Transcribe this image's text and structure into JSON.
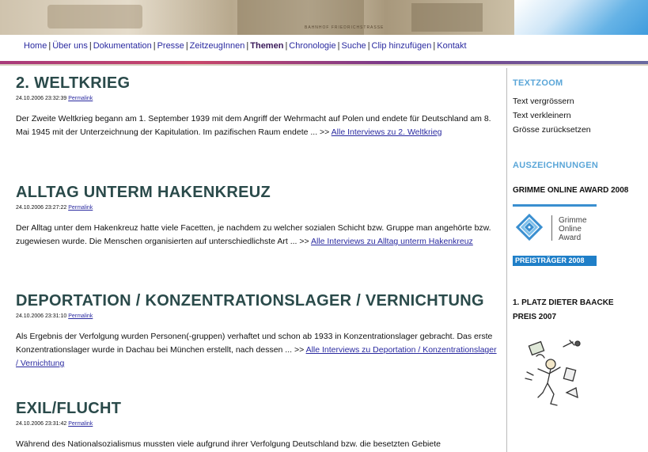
{
  "banner": {
    "caption": "BAHNHOF FRIEDRICHSTRASSE"
  },
  "nav": {
    "items": [
      {
        "label": "Home",
        "active": false
      },
      {
        "label": "Über uns",
        "active": false
      },
      {
        "label": "Dokumentation",
        "active": false
      },
      {
        "label": "Presse",
        "active": false
      },
      {
        "label": "ZeitzeugInnen",
        "active": false
      },
      {
        "label": "Themen",
        "active": true
      },
      {
        "label": "Chronologie",
        "active": false
      },
      {
        "label": "Suche",
        "active": false
      },
      {
        "label": "Clip hinzufügen",
        "active": false
      },
      {
        "label": "Kontakt",
        "active": false
      }
    ],
    "separator": "|"
  },
  "articles": [
    {
      "title": "2. WELTKRIEG",
      "timestamp": "24.10.2006 23:32:39",
      "permalink": "Permalink",
      "text": "Der Zweite Weltkrieg begann am 1. September 1939 mit dem Angriff der Wehrmacht auf Polen und endete für Deutschland am 8. Mai 1945 mit der Unterzeichnung der Kapitulation. Im pazifischen Raum endete ... >> ",
      "link": "Alle Interviews zu 2. Weltkrieg"
    },
    {
      "title": "ALLTAG UNTERM HAKENKREUZ",
      "timestamp": "24.10.2006 23:27:22",
      "permalink": "Permalink",
      "text": "Der Alltag unter dem Hakenkreuz hatte viele Facetten, je nachdem zu welcher sozialen Schicht bzw. Gruppe man angehörte bzw. zugewiesen wurde. Die Menschen organisierten auf unterschiedlichste Art ... >> ",
      "link": "Alle Interviews zu Alltag unterm Hakenkreuz"
    },
    {
      "title": "DEPORTATION / KONZENTRATIONSLAGER / VERNICHTUNG",
      "timestamp": "24.10.2006 23:31:10",
      "permalink": "Permalink",
      "text": "Als Ergebnis der Verfolgung wurden Personen(-gruppen) verhaftet und schon ab 1933 in Konzentrationslager gebracht. Das erste Konzentrationslager wurde in Dachau bei München erstellt, nach dessen ... >> ",
      "link": "Alle Interviews zu Deportation / Konzentrationslager / Vernichtung"
    },
    {
      "title": "EXIL/FLUCHT",
      "timestamp": "24.10.2006 23:31:42",
      "permalink": "Permalink",
      "text": "Während des Nationalsozialismus mussten viele aufgrund ihrer Verfolgung Deutschland bzw. die besetzten Gebiete",
      "link": ""
    }
  ],
  "sidebar": {
    "textzoom": {
      "heading": "TEXTZOOM",
      "links": [
        "Text vergrössern",
        "Text verkleinern",
        "Grösse zurücksetzen"
      ]
    },
    "awards": {
      "heading": "AUSZEICHNUNGEN",
      "award1": "GRIMME ONLINE AWARD 2008",
      "grimme_logo_text": [
        "Grimme",
        "Online",
        "Award"
      ],
      "badge": "PREISTRÄGER 2008",
      "award2_line1": "1. PLATZ DIETER BAACKE",
      "award2_line2": "PREIS 2007"
    }
  },
  "colors": {
    "heading": "#2a4a4a",
    "link": "#2a2aa0",
    "sidebar_heading": "#5aa6d8",
    "badge": "#1f7fc8"
  }
}
